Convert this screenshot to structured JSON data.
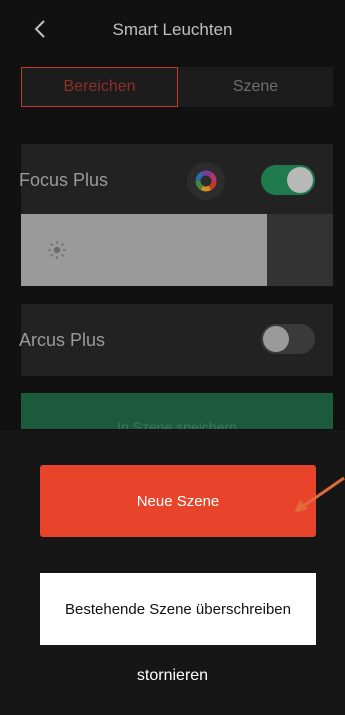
{
  "header": {
    "title": "Smart Leuchten"
  },
  "tabs": [
    {
      "label": "Bereichen",
      "active": true
    },
    {
      "label": "Szene",
      "active": false
    }
  ],
  "devices": [
    {
      "name": "Focus Plus",
      "on": true,
      "brightness": 0.79
    },
    {
      "name": "Arcus Plus",
      "on": false
    }
  ],
  "save_button": {
    "label": "In Szene speichern"
  },
  "sheet": {
    "new_scene": "Neue Szene",
    "overwrite": "Bestehende Szene überschreiben",
    "cancel": "stornieren"
  },
  "colors": {
    "accent_red": "#e8442b",
    "toggle_on": "#1f7a4e",
    "toggle_off": "#3a3a3a"
  }
}
